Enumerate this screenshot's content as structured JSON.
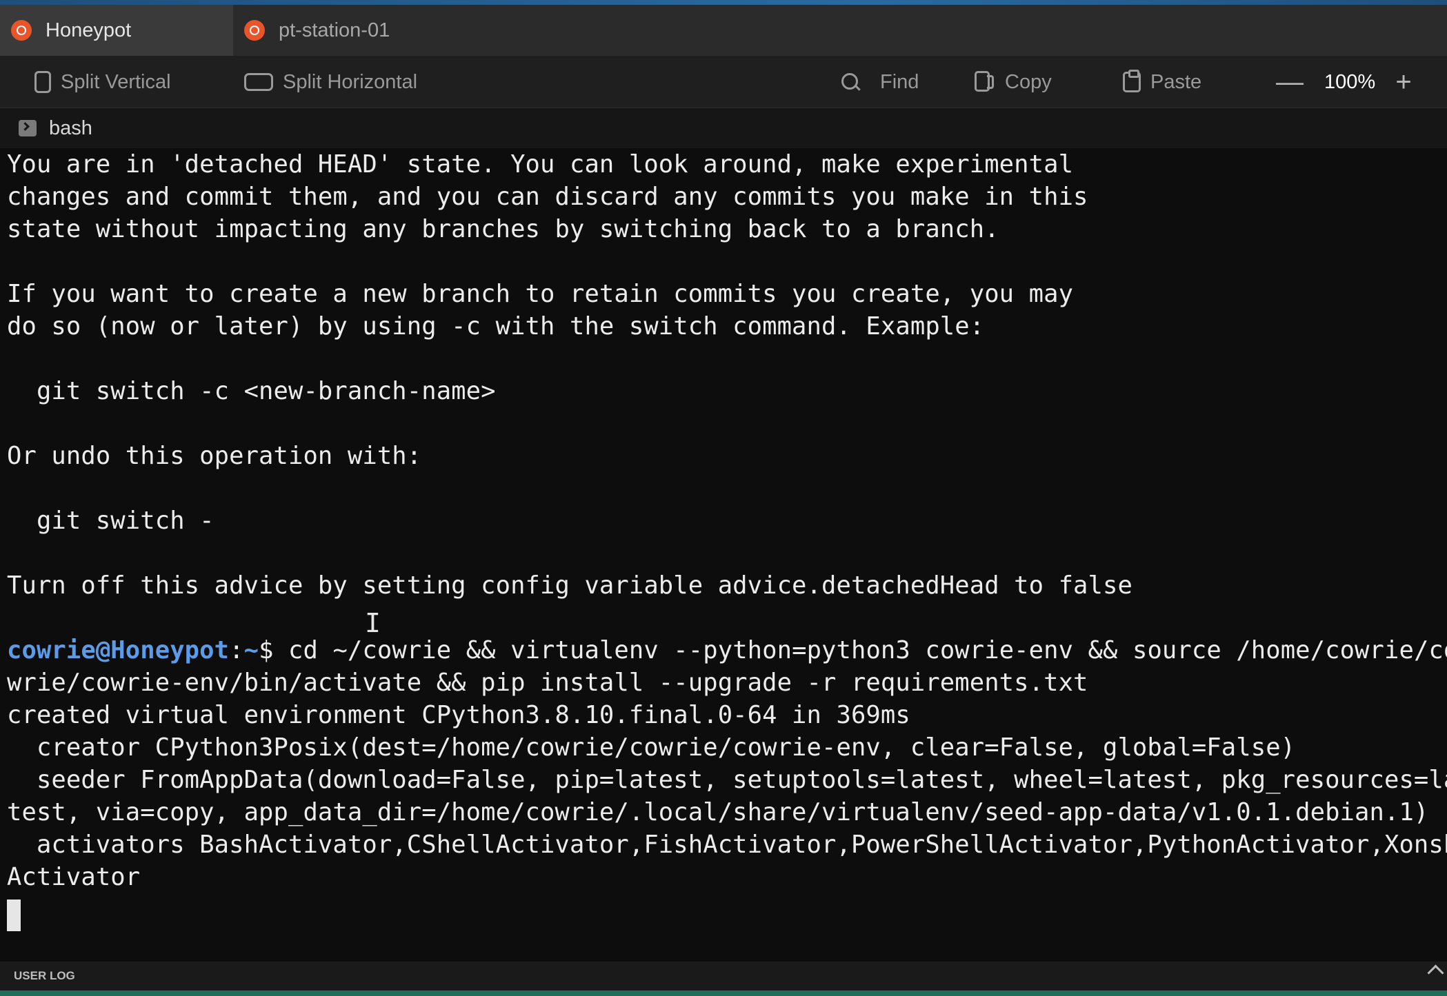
{
  "tabs": [
    {
      "label": "Honeypot",
      "active": true
    },
    {
      "label": "pt-station-01",
      "active": false
    }
  ],
  "toolbar": {
    "split_vertical": "Split Vertical",
    "split_horizontal": "Split Horizontal",
    "find": "Find",
    "copy": "Copy",
    "paste": "Paste",
    "zoom_minus": "—",
    "zoom": "100%",
    "zoom_plus": "+"
  },
  "pane": {
    "title": "bash"
  },
  "terminal": {
    "lines": [
      "You are in 'detached HEAD' state. You can look around, make experimental",
      "changes and commit them, and you can discard any commits you make in this",
      "state without impacting any branches by switching back to a branch.",
      "",
      "If you want to create a new branch to retain commits you create, you may",
      "do so (now or later) by using -c with the switch command. Example:",
      "",
      "  git switch -c <new-branch-name>",
      "",
      "Or undo this operation with:",
      "",
      "  git switch -",
      "",
      "Turn off this advice by setting config variable advice.detachedHead to false",
      ""
    ],
    "prompt_user": "cowrie@Honeypot",
    "prompt_sep": ":",
    "prompt_path": "~",
    "prompt_symbol": "$",
    "command_part1": " cd ~/cowrie && virtualenv --python=python3 cowrie-env && source /home/cowrie/co",
    "output": [
      "wrie/cowrie-env/bin/activate && pip install --upgrade -r requirements.txt",
      "created virtual environment CPython3.8.10.final.0-64 in 369ms",
      "  creator CPython3Posix(dest=/home/cowrie/cowrie/cowrie-env, clear=False, global=False)",
      "  seeder FromAppData(download=False, pip=latest, setuptools=latest, wheel=latest, pkg_resources=la",
      "test, via=copy, app_data_dir=/home/cowrie/.local/share/virtualenv/seed-app-data/v1.0.1.debian.1)",
      "  activators BashActivator,CShellActivator,FishActivator,PowerShellActivator,PythonActivator,Xonsh",
      "Activator"
    ]
  },
  "statusbar": {
    "label": "USER LOG"
  },
  "colors": {
    "background": "#0d0d0d",
    "tab_active": "#3a3a3a",
    "tab_bar": "#2b2b2b",
    "prompt": "#5b9be8",
    "ubuntu_logo": "#e8552b"
  }
}
